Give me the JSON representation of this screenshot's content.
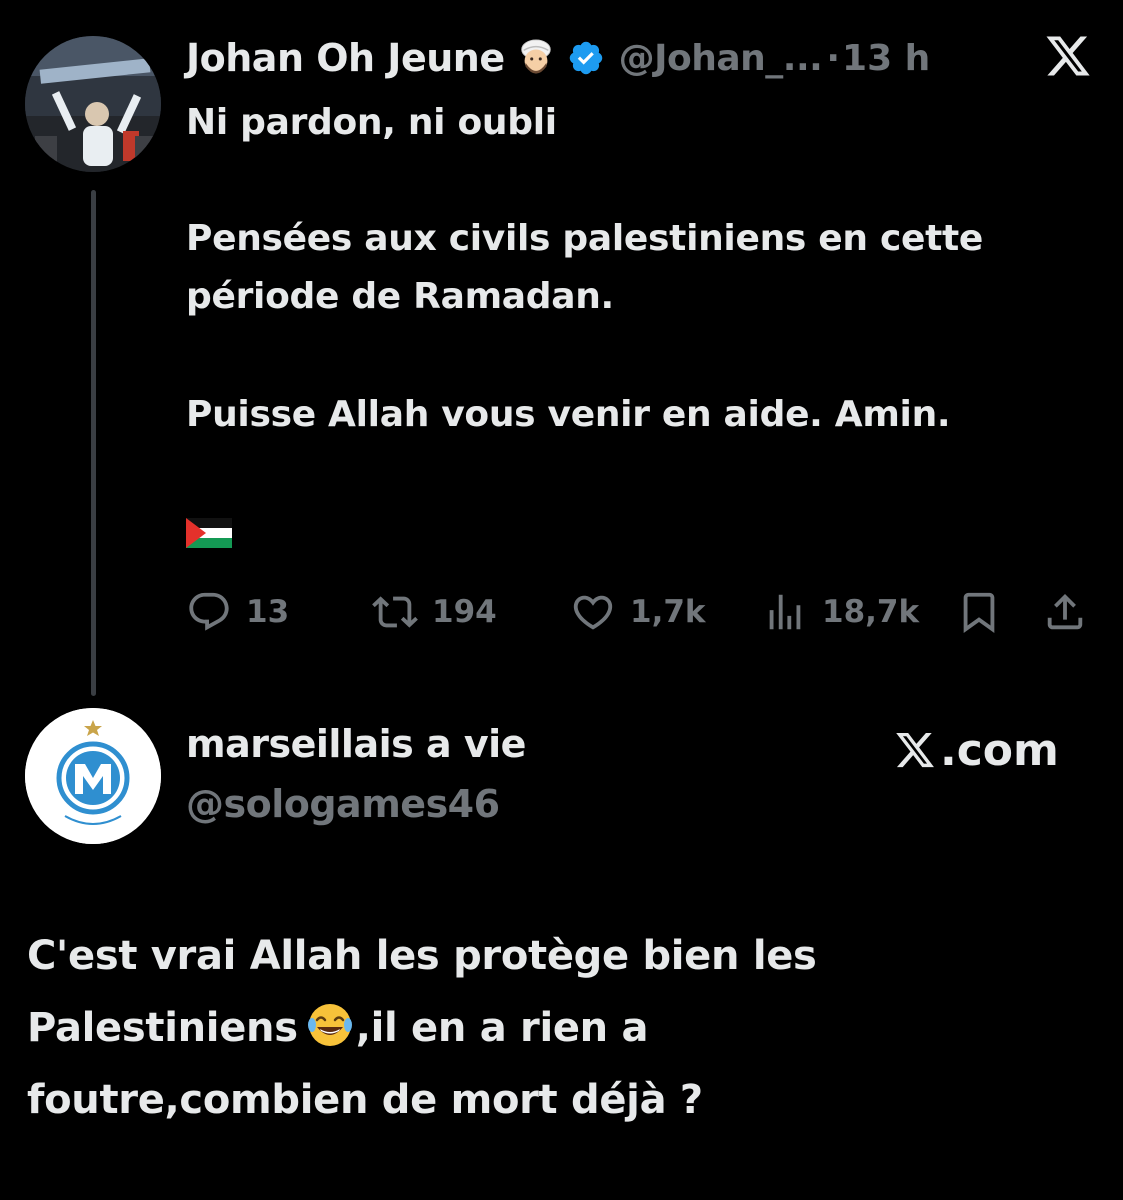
{
  "tweet1": {
    "author_name": "Johan Oh Jeune",
    "author_emoji": "man-with-turban-emoji",
    "verified": true,
    "handle": "@Johan_...",
    "separator": "·",
    "time": "13 h",
    "body": {
      "line1": "Ni pardon, ni oubli",
      "line2": "Pensées aux civils palestiniens en cette période de Ramadan.",
      "line3": "Puisse Allah vous venir en aide. Amin."
    },
    "flag": "palestine-flag-emoji",
    "actions": {
      "replies": "13",
      "reposts": "194",
      "likes": "1,7k",
      "views": "18,7k"
    }
  },
  "tweet2": {
    "author_name": "marseillais a vie",
    "handle": "@sologames46",
    "brand": ".com",
    "body": {
      "line1": "C'est vrai Allah les protège bien les",
      "line2_before": "Palestiniens",
      "line2_after": ",il en a rien a",
      "line3": "foutre,combien de mort déjà ?"
    },
    "inline_emoji": "face-with-tears-of-joy-emoji"
  },
  "colors": {
    "background": "#000000",
    "text_primary": "#e7e9ea",
    "text_secondary": "#71767b",
    "verified_blue": "#1d9bf0",
    "thread_line": "#3a3e43"
  }
}
